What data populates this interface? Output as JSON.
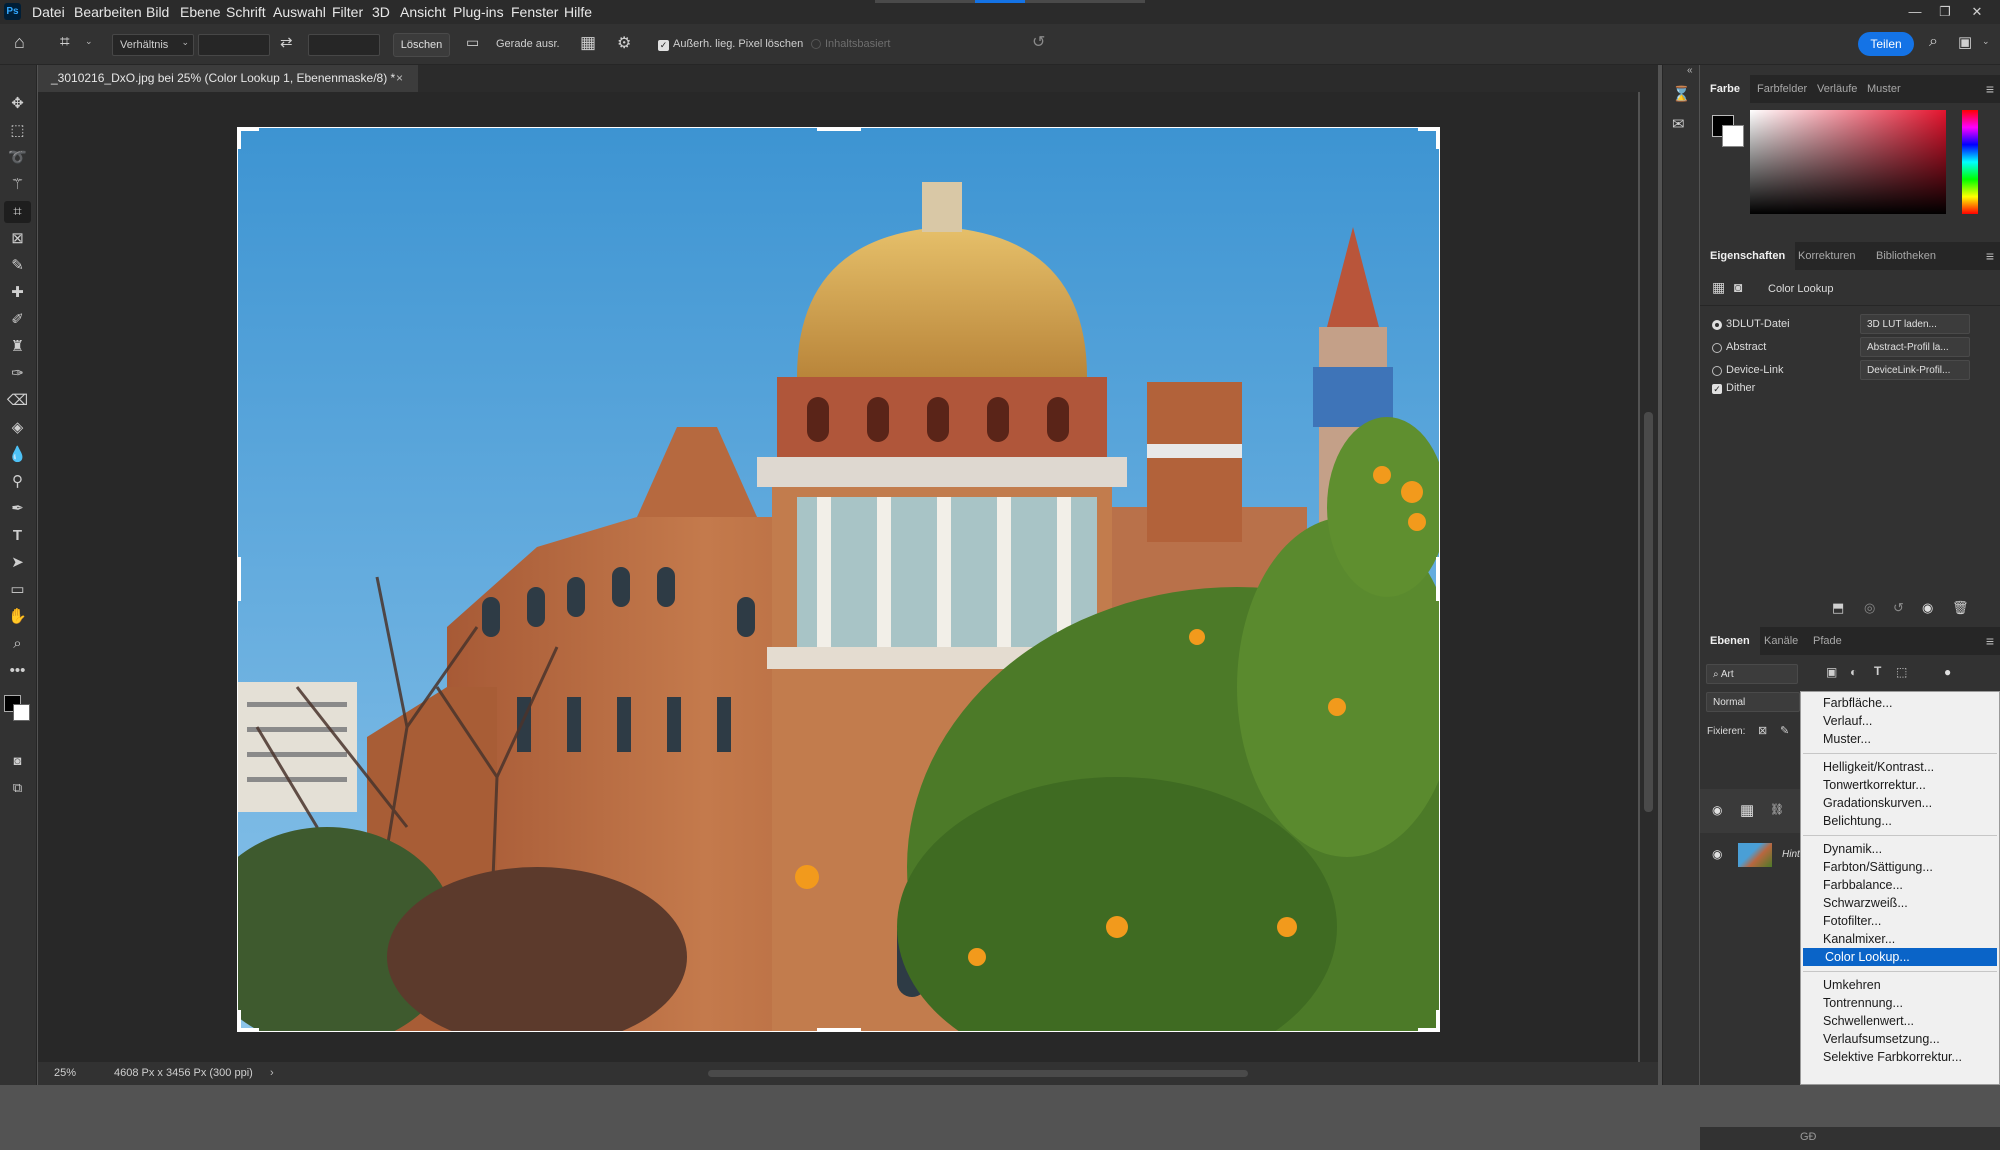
{
  "menubar": {
    "logo": "Ps",
    "items": [
      "Datei",
      "Bearbeiten",
      "Bild",
      "Ebene",
      "Schrift",
      "Auswahl",
      "Filter",
      "3D",
      "Ansicht",
      "Plug-ins",
      "Fenster",
      "Hilfe"
    ]
  },
  "options": {
    "ratio_label": "Verhältnis",
    "clear_label": "Löschen",
    "straighten_label": "Gerade ausr.",
    "delete_pixels_label": "Außerh. lieg. Pixel löschen",
    "content_aware_label": "Inhaltsbasiert",
    "share_label": "Teilen"
  },
  "document": {
    "tab_title": "_3010216_DxO.jpg bei 25% (Color Lookup 1, Ebenenmaske/8) *",
    "zoom": "25%",
    "dimensions": "4608 Px x 3456 Px (300 ppi)"
  },
  "color_panel": {
    "tabs": [
      "Farbe",
      "Farbfelder",
      "Verläufe",
      "Muster"
    ]
  },
  "properties_panel": {
    "tabs": [
      "Eigenschaften",
      "Korrekturen",
      "Bibliotheken"
    ],
    "title": "Color Lookup",
    "options": [
      {
        "label": "3DLUT-Datei",
        "select": "3D LUT laden..."
      },
      {
        "label": "Abstract",
        "select": "Abstract-Profil la..."
      },
      {
        "label": "Device-Link",
        "select": "DeviceLink-Profil..."
      }
    ],
    "dither_label": "Dither"
  },
  "layers_panel": {
    "tabs": [
      "Ebenen",
      "Kanäle",
      "Pfade"
    ],
    "filter": "Art",
    "blend_mode": "Normal",
    "lock_label": "Fixieren:",
    "background_layer": "Hint"
  },
  "dropdown": {
    "groups": [
      [
        "Farbfläche...",
        "Verlauf...",
        "Muster..."
      ],
      [
        "Helligkeit/Kontrast...",
        "Tonwertkorrektur...",
        "Gradationskurven...",
        "Belichtung..."
      ],
      [
        "Dynamik...",
        "Farbton/Sättigung...",
        "Farbbalance...",
        "Schwarzweiß...",
        "Fotofilter...",
        "Kanalmixer...",
        "Color Lookup..."
      ],
      [
        "Umkehren",
        "Tontrennung...",
        "Schwellenwert...",
        "Verlaufsumsetzung...",
        "Selektive Farbkorrektur..."
      ]
    ],
    "highlighted": "Color Lookup..."
  },
  "colors": {
    "accent": "#1473e6",
    "highlight": "#0a64c8",
    "sky": "#4a9fd6",
    "brick": "#b8673f"
  }
}
